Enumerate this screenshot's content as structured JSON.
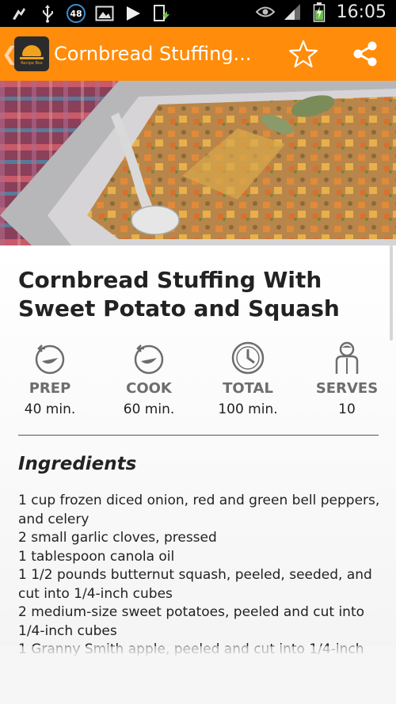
{
  "status_bar": {
    "notification_count": "48",
    "time": "16:05",
    "icons": [
      "usb-debug-icon",
      "usb-icon",
      "notification-count-badge",
      "image-icon",
      "play-icon",
      "screenshot-icon",
      "eye-icon",
      "signal-icon",
      "battery-icon"
    ]
  },
  "action_bar": {
    "app_icon_text": "Recipe Box",
    "title": "Cornbread Stuffing...",
    "accent_color": "#ff8c0a",
    "icons": [
      "back-chevron-icon",
      "star-icon",
      "share-icon"
    ]
  },
  "recipe": {
    "title": "Cornbread Stuffing With Sweet Potato and Squash",
    "stats": [
      {
        "label": "PREP",
        "value": "40 min.",
        "icon": "prep-timer-icon"
      },
      {
        "label": "COOK",
        "value": "60 min.",
        "icon": "cook-timer-icon"
      },
      {
        "label": "TOTAL",
        "value": "100 min.",
        "icon": "clock-icon"
      },
      {
        "label": "SERVES",
        "value": "10",
        "icon": "person-icon"
      }
    ],
    "ingredients_heading": "Ingredients",
    "ingredients": [
      "1 cup frozen diced onion, red and green bell peppers, and celery",
      "2 small garlic cloves, pressed",
      "1 tablespoon canola oil",
      "1 1/2 pounds butternut squash, peeled, seeded, and cut into 1/4-inch cubes",
      "2 medium-size sweet potatoes, peeled and cut into 1/4-inch cubes",
      "1 Granny Smith apple, peeled and cut into 1/4-inch"
    ]
  }
}
